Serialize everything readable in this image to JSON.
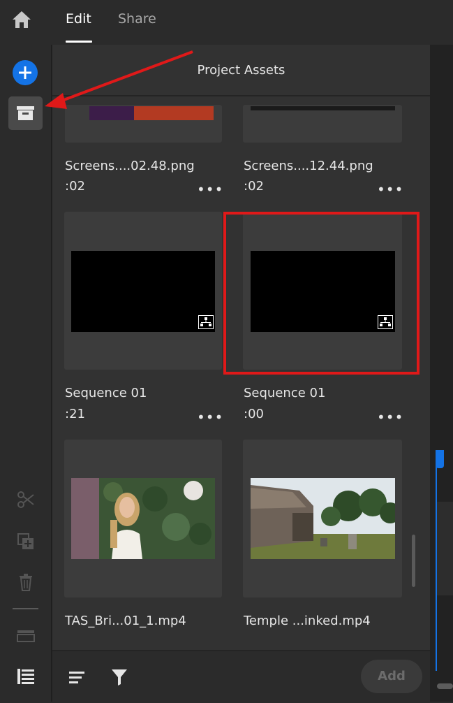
{
  "tabs": [
    {
      "label": "Edit",
      "active": true
    },
    {
      "label": "Share",
      "active": false
    }
  ],
  "panel": {
    "title": "Project Assets"
  },
  "assets": [
    {
      "name": "Screens....02.48.png",
      "duration": ":02"
    },
    {
      "name": "Screens....12.44.png",
      "duration": ":02"
    },
    {
      "name": "Sequence 01",
      "duration": ":21"
    },
    {
      "name": "Sequence 01",
      "duration": ":00"
    },
    {
      "name": "TAS_Bri...01_1.mp4",
      "duration": ""
    },
    {
      "name": "Temple ...inked.mp4",
      "duration": ""
    }
  ],
  "more_label": "•••",
  "bottom": {
    "add_label": "Add"
  },
  "icons": {
    "home": "home-icon",
    "add": "plus-circle-icon",
    "archive": "archive-box-icon",
    "cut": "scissors-icon",
    "duplicate": "duplicate-icon",
    "delete": "trash-icon",
    "card": "card-icon",
    "list": "list-icon",
    "sort": "sort-icon",
    "filter": "filter-icon",
    "sequence": "sequence-icon"
  },
  "colors": {
    "accent": "#1473e6",
    "annotation": "#e01919"
  }
}
